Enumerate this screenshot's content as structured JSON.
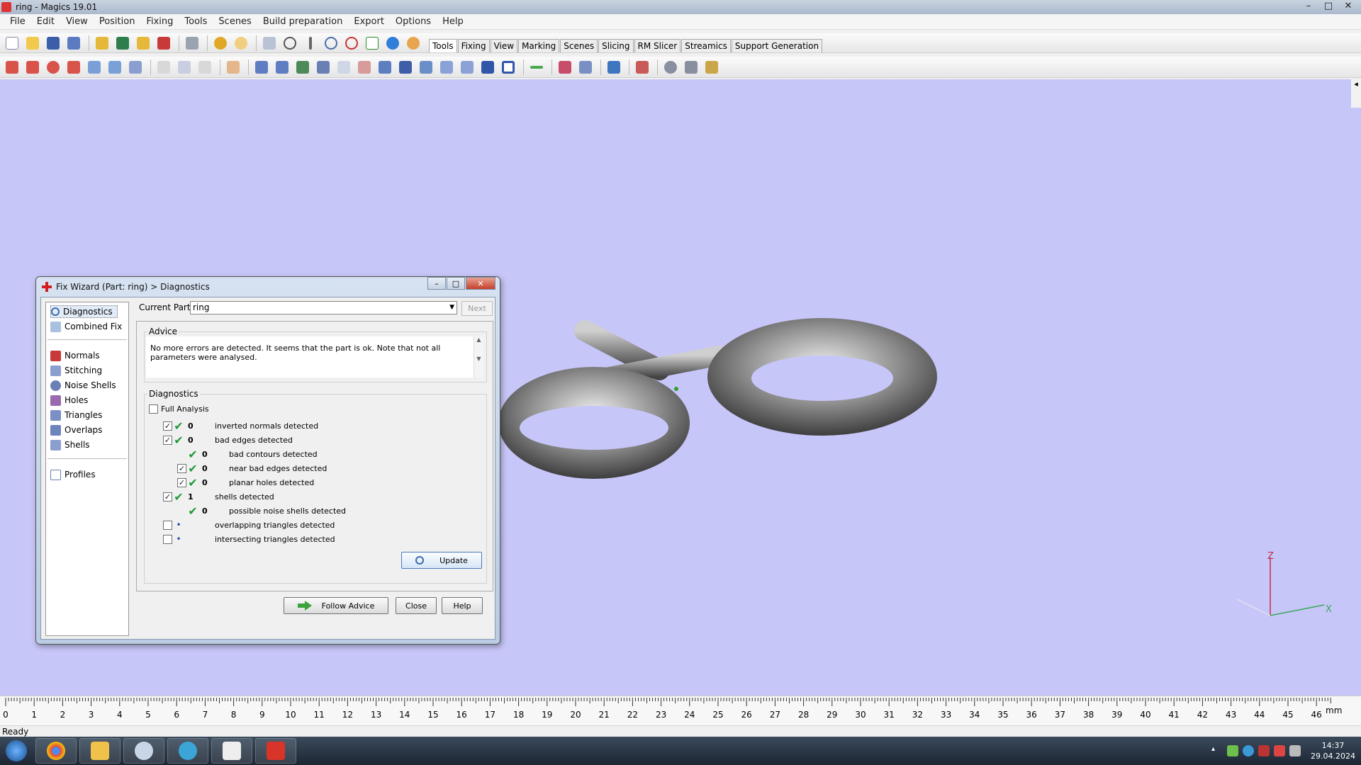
{
  "window": {
    "title": "ring - Magics 19.01",
    "minimize": "–",
    "maximize": "□",
    "close": "✕"
  },
  "menu": [
    "File",
    "Edit",
    "View",
    "Position",
    "Fixing",
    "Tools",
    "Scenes",
    "Build preparation",
    "Export",
    "Options",
    "Help"
  ],
  "tabs": [
    "Tools",
    "Fixing",
    "View",
    "Marking",
    "Scenes",
    "Slicing",
    "RM Slicer",
    "Streamics",
    "Support Generation"
  ],
  "active_tab": "Tools",
  "viewport": {
    "background": "#c7c6f8",
    "axis_z_label": "Z",
    "axis_x_label": "X",
    "side_handle": "◂"
  },
  "ruler": {
    "ticks": [
      "0",
      "1",
      "2",
      "3",
      "4",
      "5",
      "6",
      "7",
      "8",
      "9",
      "10",
      "11",
      "12",
      "13",
      "14",
      "15",
      "16",
      "17",
      "18",
      "19",
      "20",
      "21",
      "22",
      "23",
      "24",
      "25",
      "26",
      "27",
      "28",
      "29",
      "30",
      "31",
      "32",
      "33",
      "34",
      "35",
      "36",
      "37",
      "38",
      "39",
      "40",
      "41",
      "42",
      "43",
      "44",
      "45",
      "46"
    ],
    "unit": "mm"
  },
  "status": "Ready",
  "clock": {
    "time": "14:37",
    "date": "29.04.2024"
  },
  "dialog": {
    "title": "Fix Wizard (Part: ring) > Diagnostics",
    "nav_top": [
      "Diagnostics",
      "Combined Fix"
    ],
    "nav_mid": [
      "Normals",
      "Stitching",
      "Noise Shells",
      "Holes",
      "Triangles",
      "Overlaps",
      "Shells"
    ],
    "nav_bottom": [
      "Profiles"
    ],
    "current_part_label": "Current Part:",
    "current_part_value": "ring",
    "next_label": "Next",
    "advice_legend": "Advice",
    "advice_text": "No more errors are detected. It seems that the part is ok. Note that not all parameters were analysed.",
    "diagnostics_legend": "Diagnostics",
    "full_analysis_label": "Full Analysis",
    "rows": [
      {
        "checked": true,
        "status": "ok",
        "count": "0",
        "label": "inverted normals detected",
        "indent": 0
      },
      {
        "checked": true,
        "status": "ok",
        "count": "0",
        "label": "bad edges detected",
        "indent": 0
      },
      {
        "checked": null,
        "status": "ok",
        "count": "0",
        "label": "bad contours detected",
        "indent": 1
      },
      {
        "checked": true,
        "status": "ok",
        "count": "0",
        "label": "near bad edges detected",
        "indent": 1
      },
      {
        "checked": true,
        "status": "ok",
        "count": "0",
        "label": "planar holes detected",
        "indent": 1
      },
      {
        "checked": true,
        "status": "ok",
        "count": "1",
        "label": "shells detected",
        "indent": 0
      },
      {
        "checked": null,
        "status": "ok",
        "count": "0",
        "label": "possible noise shells detected",
        "indent": 1
      },
      {
        "checked": false,
        "status": "pending",
        "count": "",
        "label": "overlapping triangles detected",
        "indent": 0
      },
      {
        "checked": false,
        "status": "pending",
        "count": "",
        "label": "intersecting triangles detected",
        "indent": 0
      }
    ],
    "update_label": "Update",
    "follow_advice_label": "Follow Advice",
    "close_label": "Close",
    "help_label": "Help"
  }
}
